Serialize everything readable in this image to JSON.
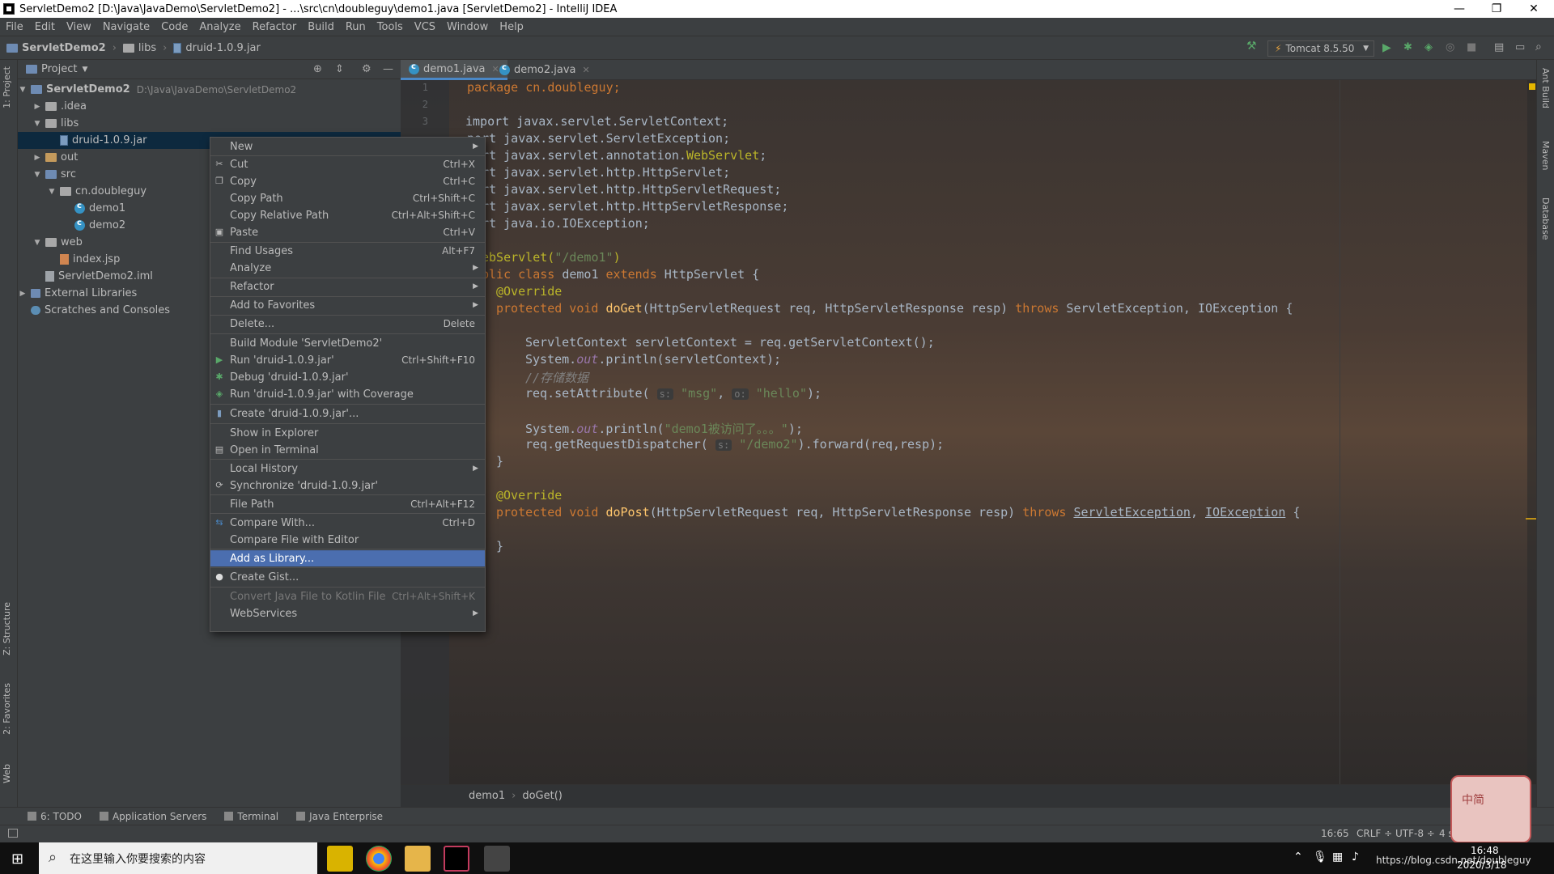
{
  "window": {
    "title": "ServletDemo2 [D:\\Java\\JavaDemo\\ServletDemo2] - ...\\src\\cn\\doubleguy\\demo1.java [ServletDemo2] - IntelliJ IDEA",
    "minimize": "—",
    "maximize": "❐",
    "close": "✕"
  },
  "menubar": [
    "File",
    "Edit",
    "View",
    "Navigate",
    "Code",
    "Analyze",
    "Refactor",
    "Build",
    "Run",
    "Tools",
    "VCS",
    "Window",
    "Help"
  ],
  "breadcrumb": {
    "project": "ServletDemo2",
    "folder": "libs",
    "file": "druid-1.0.9.jar"
  },
  "toolbar": {
    "run_config": "Tomcat 8.5.50"
  },
  "left_tool_tabs": {
    "project": "1: Project",
    "structure": "Z: Structure",
    "favorites": "2: Favorites",
    "web": "Web"
  },
  "right_tool_tabs": {
    "ant": "Ant Build",
    "maven": "Maven",
    "database": "Database"
  },
  "project_panel": {
    "title": "Project",
    "tree": [
      {
        "label": "ServletDemo2",
        "extra": "D:\\Java\\JavaDemo\\ServletDemo2",
        "arrow": "▼",
        "icon": "folder"
      },
      {
        "label": ".idea",
        "arrow": "▶",
        "icon": "folder"
      },
      {
        "label": "libs",
        "arrow": "▼",
        "icon": "folder"
      },
      {
        "label": "druid-1.0.9.jar",
        "arrow": "",
        "icon": "jar"
      },
      {
        "label": "out",
        "arrow": "▶",
        "icon": "folder"
      },
      {
        "label": "src",
        "arrow": "▼",
        "icon": "folder"
      },
      {
        "label": "cn.doubleguy",
        "arrow": "▼",
        "icon": "package"
      },
      {
        "label": "demo1",
        "arrow": "",
        "icon": "class"
      },
      {
        "label": "demo2",
        "arrow": "",
        "icon": "class"
      },
      {
        "label": "web",
        "arrow": "▼",
        "icon": "folder"
      },
      {
        "label": "index.jsp",
        "arrow": "",
        "icon": "file"
      },
      {
        "label": "ServletDemo2.iml",
        "arrow": "",
        "icon": "file"
      },
      {
        "label": "External Libraries",
        "arrow": "▶",
        "icon": "library"
      },
      {
        "label": "Scratches and Consoles",
        "arrow": "",
        "icon": "scratch"
      }
    ]
  },
  "editor_tabs": [
    {
      "label": "demo1.java",
      "close": "✕"
    },
    {
      "label": "demo2.java",
      "close": "✕"
    }
  ],
  "gutter": [
    "1",
    "2",
    "3"
  ],
  "code": {
    "l1": "package cn.doubleguy;",
    "l3a": "import javax.servlet.ServletContext;",
    "l4": "port javax.servlet.ServletException;",
    "l5a": "port javax.servlet.annotation.",
    "l5b": "WebServlet",
    "l5c": ";",
    "l6": "port javax.servlet.http.HttpServlet;",
    "l7": "port javax.servlet.http.HttpServletRequest;",
    "l8": "port javax.servlet.http.HttpServletResponse;",
    "l9": "port java.io.IOException;",
    "l11a": "ebServlet(",
    "l11b": "\"/demo1\"",
    "l11c": ")",
    "l12a": "blic class ",
    "l12b": "demo1 ",
    "l12c": "extends ",
    "l12d": "HttpServlet {",
    "l13": "@Override",
    "l14a": "protected void ",
    "l14b": "doGet",
    "l14c": "(HttpServletRequest req, HttpServletResponse resp) ",
    "l14d": "throws ",
    "l14e": "ServletException, IOException {",
    "l16": "ServletContext servletContext = req.getServletContext();",
    "l17a": "System.",
    "l17b": "out",
    "l17c": ".println(servletContext);",
    "l18": "//存储数据",
    "l19a": "req.setAttribute( ",
    "l19h1": "s:",
    "l19b": " \"msg\"",
    "l19c": ", ",
    "l19h2": "o:",
    "l19d": " \"hello\"",
    "l19e": ");",
    "l21a": "System.",
    "l21b": "out",
    "l21c": ".println(",
    "l21d": "\"demo1被访问了。。。\"",
    "l21e": ");",
    "l22a": "req.getRequestDispatcher( ",
    "l22h": "s:",
    "l22b": " \"/demo2\"",
    "l22c": ").forward(req,resp);",
    "l23": "}",
    "l25": "@Override",
    "l26a": "protected void ",
    "l26b": "doPost",
    "l26c": "(HttpServletRequest req, HttpServletResponse resp) ",
    "l26d": "throws ",
    "l26e": "ServletException",
    "l26f": ", ",
    "l26g": "IOException",
    "l26h": " {",
    "l28": "}"
  },
  "editor_breadcrumb": {
    "class": "demo1",
    "method": "doGet()"
  },
  "context_menu": [
    {
      "label": "New",
      "shortcut": "",
      "submenu": true
    },
    {
      "label": "Cut",
      "shortcut": "Ctrl+X"
    },
    {
      "label": "Copy",
      "shortcut": "Ctrl+C"
    },
    {
      "label": "Copy Path",
      "shortcut": "Ctrl+Shift+C"
    },
    {
      "label": "Copy Relative Path",
      "shortcut": "Ctrl+Alt+Shift+C"
    },
    {
      "label": "Paste",
      "shortcut": "Ctrl+V"
    },
    {
      "label": "Find Usages",
      "shortcut": "Alt+F7"
    },
    {
      "label": "Analyze",
      "shortcut": "",
      "submenu": true
    },
    {
      "label": "Refactor",
      "shortcut": "",
      "submenu": true
    },
    {
      "label": "Add to Favorites",
      "shortcut": "",
      "submenu": true
    },
    {
      "label": "Delete...",
      "shortcut": "Delete"
    },
    {
      "label": "Build Module 'ServletDemo2'",
      "shortcut": ""
    },
    {
      "label": "Run 'druid-1.0.9.jar'",
      "shortcut": "Ctrl+Shift+F10"
    },
    {
      "label": "Debug 'druid-1.0.9.jar'",
      "shortcut": ""
    },
    {
      "label": "Run 'druid-1.0.9.jar' with Coverage",
      "shortcut": ""
    },
    {
      "label": "Create 'druid-1.0.9.jar'...",
      "shortcut": ""
    },
    {
      "label": "Show in Explorer",
      "shortcut": ""
    },
    {
      "label": "Open in Terminal",
      "shortcut": ""
    },
    {
      "label": "Local History",
      "shortcut": "",
      "submenu": true
    },
    {
      "label": "Synchronize 'druid-1.0.9.jar'",
      "shortcut": ""
    },
    {
      "label": "File Path",
      "shortcut": "Ctrl+Alt+F12"
    },
    {
      "label": "Compare With...",
      "shortcut": "Ctrl+D"
    },
    {
      "label": "Compare File with Editor",
      "shortcut": ""
    },
    {
      "label": "Add as Library...",
      "shortcut": ""
    },
    {
      "label": "Create Gist...",
      "shortcut": ""
    },
    {
      "label": "Convert Java File to Kotlin File",
      "shortcut": "Ctrl+Alt+Shift+K"
    },
    {
      "label": "WebServices",
      "shortcut": "",
      "submenu": true
    }
  ],
  "submenu_arrow": "▶",
  "bottom_tabs": [
    "6: TODO",
    "Application Servers",
    "Terminal",
    "Java Enterprise"
  ],
  "status": {
    "position": "16:65",
    "line_sep": "CRLF ÷",
    "encoding": "UTF-8 ÷",
    "indent": "4 s"
  },
  "taskbar": {
    "search_placeholder": "在这里输入你要搜索的内容",
    "time": "16:48",
    "date": "2020/3/18",
    "watermark": "https://blog.csdn.net/doubleguy"
  },
  "colors": {
    "highlight": "#4b6eaf",
    "panel": "#3c3f41",
    "editor_bg": "#2b2b2b",
    "keyword": "#cc7832",
    "string": "#6a8759",
    "annotation": "#bbb529"
  }
}
